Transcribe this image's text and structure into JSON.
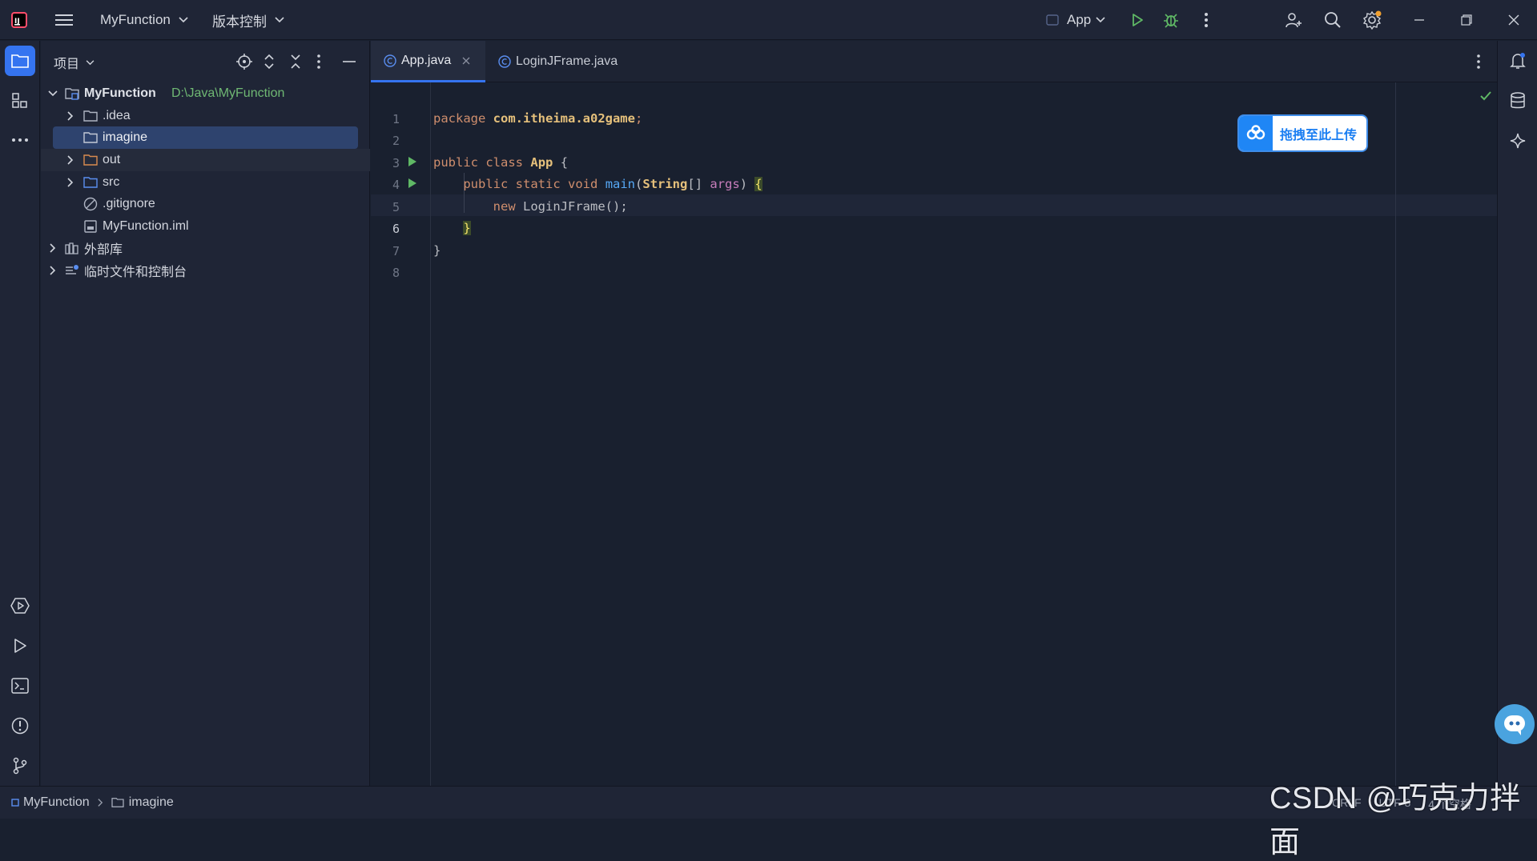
{
  "titlebar": {
    "project_name": "MyFunction",
    "vcs_label": "版本控制",
    "run_config": "App"
  },
  "project_panel": {
    "title": "项目",
    "root": {
      "label": "MyFunction",
      "path": "D:\\Java\\MyFunction"
    },
    "items": [
      {
        "label": ".idea",
        "type": "folder"
      },
      {
        "label": "imagine",
        "type": "folder",
        "selected": true
      },
      {
        "label": "out",
        "type": "folder-excluded"
      },
      {
        "label": "src",
        "type": "folder-source"
      },
      {
        "label": ".gitignore",
        "type": "gitignore-file"
      },
      {
        "label": "MyFunction.iml",
        "type": "iml-file"
      }
    ],
    "external_libs": "外部库",
    "scratches": "临时文件和控制台"
  },
  "tabs": [
    {
      "label": "App.java",
      "active": true
    },
    {
      "label": "LoginJFrame.java",
      "active": false
    }
  ],
  "code": {
    "line_numbers": [
      "1",
      "2",
      "3",
      "4",
      "5",
      "6",
      "7",
      "8"
    ],
    "current_line": 6,
    "l1": {
      "kw": "package",
      "pkg": "com.itheima.a02game",
      "semi": ";"
    },
    "l3": {
      "kw1": "public",
      "kw2": "class",
      "cls": "App",
      "brace": "{"
    },
    "l4": {
      "kw1": "public",
      "kw2": "static",
      "kw3": "void",
      "fn": "main",
      "p1": "(",
      "typ": "String",
      "arr": "[]",
      "param": "args",
      "p2": ")",
      "brace": "{"
    },
    "l5": {
      "kw": "new",
      "call": "LoginJFrame();"
    },
    "l6": {
      "brace": "}"
    },
    "l7": {
      "brace": "}"
    }
  },
  "upload_widget": {
    "label": "拖拽至此上传"
  },
  "breadcrumb": {
    "project": "MyFunction",
    "folder": "imagine"
  },
  "status": {
    "line_sep": "CRLF",
    "encoding": "UTF-8",
    "indent": "4 个空格"
  },
  "watermark": "CSDN @巧克力拌面",
  "colors": {
    "accent": "#3574f0",
    "run_green": "#5fb865",
    "selection": "#2e436e"
  }
}
